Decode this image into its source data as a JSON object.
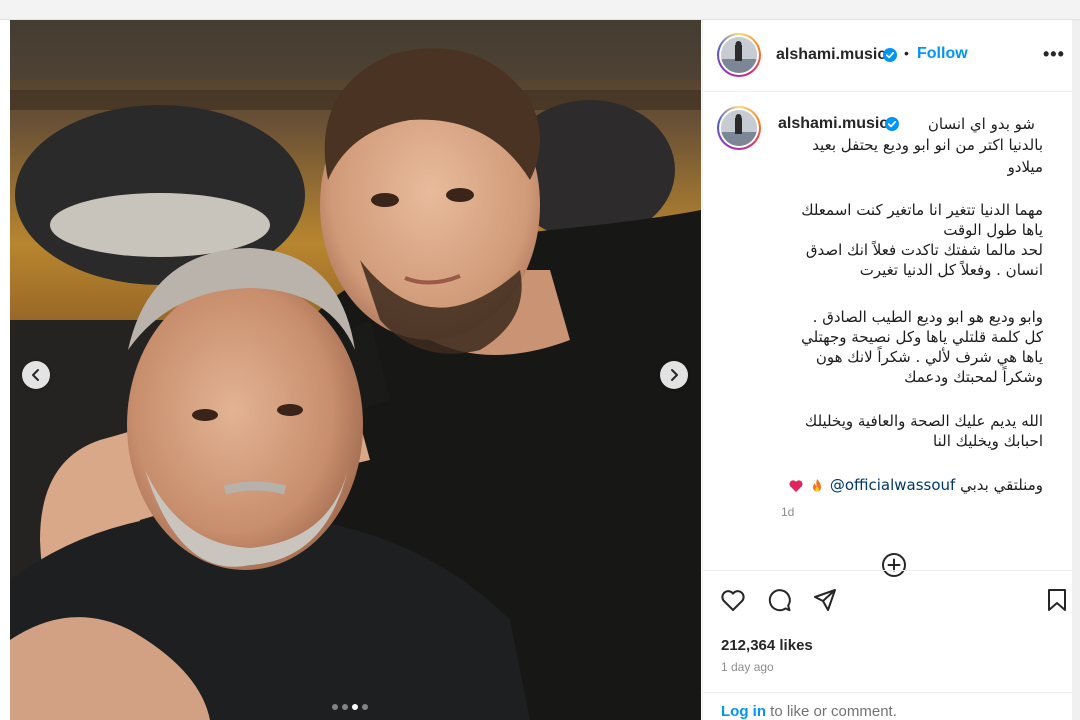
{
  "post": {
    "username": "alshami.music",
    "follow_label": "Follow",
    "separator": "•",
    "more_label": "•••",
    "caption": {
      "line1": "شو بدو اي انسان",
      "line2": "بالدنيا اكتر من انو ابو وديع يحتفل بعيد",
      "line3": "ميلادو",
      "para2": [
        "مهما الدنيا تتغير انا ماتغير كنت اسمعلك",
        "ياها طول الوقت",
        "لحد مالما شفتك تاكدت فعلاً انك اصدق",
        "انسان . وفعلاً كل الدنيا تغيرت"
      ],
      "para3": [
        "وابو وديع هو ابو وديع الطيب الصادق .",
        "كل كلمة قلتلي ياها وكل نصيحة وجهتلي",
        "ياها هي شرف لألي . شكراً لانك هون",
        "وشكراً لمحبتك ودعمك"
      ],
      "para4": [
        "الله يديم عليك الصحة والعافية ويخليلك",
        "احبابك ويخليك النا"
      ],
      "closing_text": "ومنلتقي بدبي",
      "mention": "@officialwassouf"
    },
    "time_short": "1d",
    "likes": "212,364 likes",
    "posted_ago": "1 day ago",
    "login": {
      "link": "Log in",
      "rest": " to like or comment."
    }
  },
  "carousel": {
    "total_slides": 4,
    "active_slide": 3
  },
  "icons": {
    "verified": "verified-badge-icon",
    "heart": "heart-icon",
    "comment": "comment-icon",
    "share": "share-icon",
    "save": "bookmark-icon",
    "add": "add-comment-icon",
    "prev": "chevron-left-icon",
    "next": "chevron-right-icon"
  },
  "colors": {
    "accent": "#0095f6",
    "verified": "#0095f6",
    "text": "#262626",
    "muted": "#8e8e8e"
  }
}
